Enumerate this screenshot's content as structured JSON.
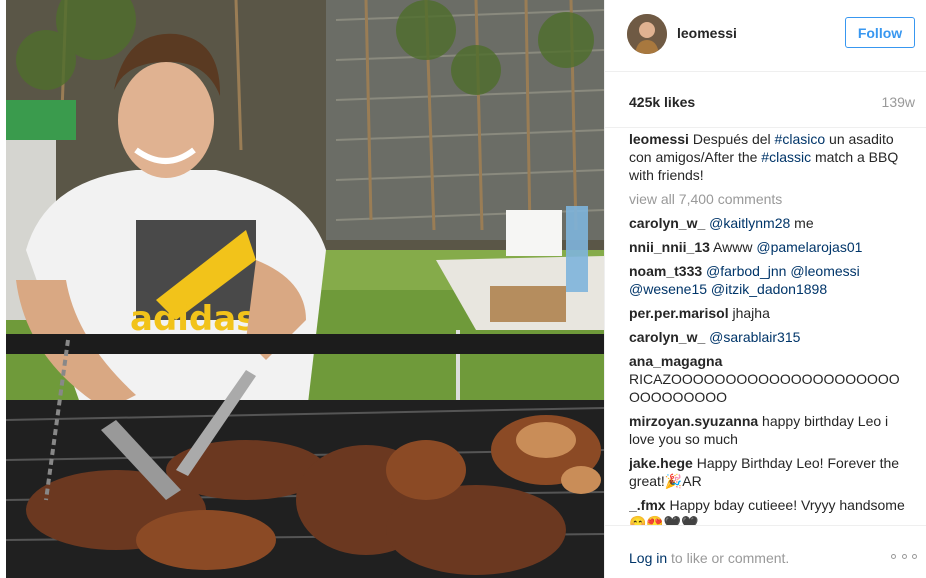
{
  "post": {
    "photo_name": "messi-bbq-photo",
    "username": "leomessi",
    "follow_label": "Follow",
    "likes": "425k likes",
    "age": "139w",
    "caption": {
      "user": "leomessi",
      "text_1": " Después del ",
      "tag_1": "#clasico",
      "text_2": " un asadito con amigos/After the ",
      "tag_2": "#classic",
      "text_3": " match a BBQ with friends!"
    },
    "view_all": "view all 7,400 comments",
    "comments": [
      {
        "user": "carolyn_w_",
        "pre": " ",
        "tag": "@kaitlynm28",
        "post": " me"
      },
      {
        "user": "nnii_nnii_13",
        "pre": " Awww ",
        "tag": "@pamelarojas01",
        "post": ""
      },
      {
        "user": "noam_t333",
        "pre": " ",
        "tag": "@farbod_jnn @leomessi @wesene15 @itzik_dadon1898",
        "post": ""
      },
      {
        "user": "per.per.marisol",
        "pre": " jhajha",
        "tag": "",
        "post": ""
      },
      {
        "user": "carolyn_w_",
        "pre": " ",
        "tag": "@sarablair315",
        "post": ""
      },
      {
        "user": "ana_magagna",
        "pre": " RICAZOOOOOOOOOOOOOOOOOOOOOOOOOOOOOO",
        "tag": "",
        "post": ""
      },
      {
        "user": "mirzoyan.syuzanna",
        "pre": " happy birthday Leo i love you so much",
        "tag": "",
        "post": ""
      },
      {
        "user": "jake.hege",
        "pre": " Happy Birthday Leo! Forever the great!🎉AR",
        "tag": "",
        "post": ""
      },
      {
        "user": "_.fmx",
        "pre": " Happy bday cutieee! Vryyy handsome😊😍🖤🖤",
        "tag": "",
        "post": ""
      }
    ],
    "footer": {
      "login_link": "Log in",
      "login_text": " to like or comment."
    },
    "more_icon": "more-options-icon"
  }
}
